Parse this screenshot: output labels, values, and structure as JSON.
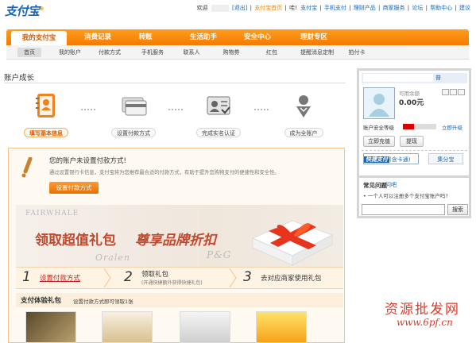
{
  "topbar": {
    "logo": "支付宝",
    "logo_tm": "®",
    "welcome": "欢迎",
    "logout": "[退出]",
    "links": [
      "支付宝首页",
      "哇!",
      "支付宝",
      "手机支付",
      "理财产品",
      "商家服务",
      "论坛",
      "帮助中心",
      "建议"
    ]
  },
  "mainnav": {
    "tabs": [
      "我的支付宝",
      "消费记录",
      "转账",
      "生活助手",
      "安全中心",
      "理财专区"
    ]
  },
  "subnav": {
    "items": [
      "首页",
      "我的账户",
      "付款方式",
      "手机服务",
      "联系人",
      "购物券",
      "红包",
      "提醒消息定制",
      "拍付卡"
    ]
  },
  "growth": {
    "title": "账户成长",
    "steps": [
      "填写基本信息",
      "设置付款方式",
      "完成实名认证",
      "成为全账户"
    ]
  },
  "notice": {
    "title": "您的账户未设置付款方式!",
    "desc": "通过设置银行卡信息，支付宝将为您推荐最合适的付款方式，有助于提升您购物支付的便捷性和安全性。",
    "button": "设置付款方式"
  },
  "banner": {
    "brand1": "FAIRWHALE",
    "brand2": "Oralen",
    "brand3": "P&G",
    "text1": "领取超值礼包",
    "text2": "尊享品牌折扣"
  },
  "promo_steps": {
    "n1": "1",
    "s1": "设置付款方式",
    "n2": "2",
    "s2": "领取礼包",
    "s2_sub": "(开通快捷额外获得快捷礼包)",
    "n3": "3",
    "s3": "去对应商家使用礼包"
  },
  "gift": {
    "title": "支付体验礼包",
    "subtitle": "设置付款方式即可领取1张"
  },
  "account": {
    "badge": "普",
    "avail_label": "可用余额",
    "avail_value": "0.00元",
    "security_label": "账户安全等级",
    "security_level": 0.33,
    "upgrade": "立即升级",
    "btn_recharge": "立即充值",
    "btn_withdraw": "提现",
    "quickpay_logo": "快捷支付",
    "quickpay_text": "(含卡通)",
    "share": "集分宝"
  },
  "faq": {
    "title": "常见问题",
    "ask": "问吧",
    "item": "• 一个人可以注册多个支付宝账户吗?",
    "search_button": "搜索"
  },
  "watermark": {
    "line1": "资源批发网",
    "line2": "www.6pf.cn"
  },
  "colors": {
    "brand_blue": "#1766b5",
    "brand_orange": "#f57a00",
    "alert_red": "#c61e1e"
  }
}
